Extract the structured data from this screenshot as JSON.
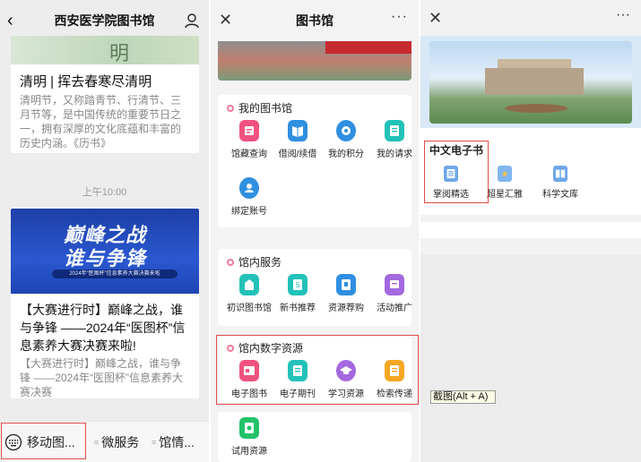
{
  "panel1": {
    "title": "西安医学院图书馆",
    "card1_img_text": "明",
    "card1_title": "清明 | 挥去春寒尽清明",
    "card1_body": "清明节，又称踏青节、行清节、三月节等，是中国传统的重要节日之一，拥有深厚的文化底蕴和丰富的历史内涵。《历书》",
    "time": "上午10:00",
    "banner_line1": "巅峰之战",
    "banner_line2": "谁与争锋",
    "banner_line3": "2024年“医图杯”信息素养大赛决赛来啦",
    "card2_title": "【大赛进行时】巅峰之战，谁与争锋 ——2024年“医图杯”信息素养大赛决赛来啦!",
    "card2_body": "【大赛进行时】巅峰之战，谁与争锋 ——2024年“医图杯”信息素养大赛决赛",
    "menu": [
      "移动图...",
      "微服务",
      "馆情..."
    ]
  },
  "panel2": {
    "title": "图书馆",
    "more": "···",
    "sec1_title": "我的图书馆",
    "sec1_items": [
      "馆藏查询",
      "借阅/续借",
      "我的积分",
      "我的请求",
      "绑定账号"
    ],
    "sec2_title": "馆内服务",
    "sec2_items": [
      "初识图书馆",
      "新书推荐",
      "资源荐购",
      "活动推广"
    ],
    "sec3_title": "馆内数字资源",
    "sec3_items": [
      "电子图书",
      "电子期刊",
      "学习资源",
      "检索传递"
    ],
    "sec4_items": [
      "试用资源"
    ]
  },
  "panel3": {
    "more": "···",
    "section_title": "中文电子书",
    "items": [
      "掌阅精选",
      "超星汇雅",
      "科学文库"
    ],
    "tooltip": "截图(Alt + A)"
  },
  "colors": {
    "highlight_red": "#e04a4a",
    "pink_icon": "#f0527f",
    "blue_icon": "#2f8fe0",
    "teal_icon": "#22c2b8",
    "purple_icon": "#a468e0",
    "orange_icon": "#f5a623"
  }
}
